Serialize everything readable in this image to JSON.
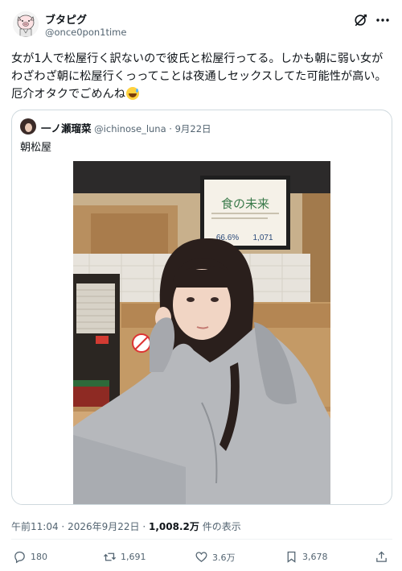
{
  "author": {
    "display_name": "ブタピグ",
    "handle": "@once0pon1time"
  },
  "tweet": {
    "lines": [
      "女が1人で松屋行く訳ないので彼氏と松屋行ってる。しかも朝に弱い女が",
      "わざわざ朝に松屋行くっってことは夜通しセックスしてた可能性が高い。",
      "厄介オタクでごめんね"
    ]
  },
  "quote": {
    "name": "一ノ瀬瑠菜",
    "handle": "@ichinose_luna",
    "separator": "·",
    "date": "9月22日",
    "text": "朝松屋",
    "poster_title": "食の未来",
    "poster_stats": [
      "66.6%",
      "1,071"
    ]
  },
  "meta": {
    "time": "午前11:04",
    "separator": "·",
    "date": "2026年9月22日",
    "separator2": "·",
    "views": "1,008.2万",
    "views_label": "件の表示"
  },
  "actions": {
    "replies": "180",
    "reposts": "1,691",
    "likes": "3.6万",
    "bookmarks": "3,678"
  },
  "colors": {
    "text": "#0f1419",
    "secondary": "#536471",
    "border": "#cfd9de"
  }
}
